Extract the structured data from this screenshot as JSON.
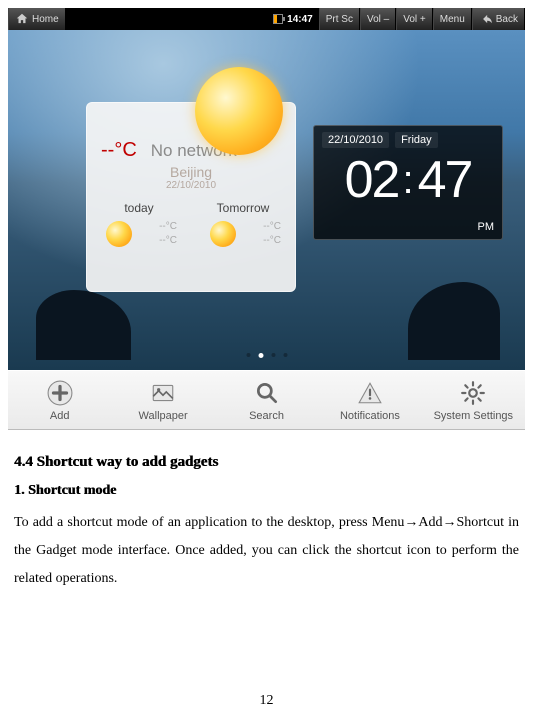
{
  "topbar": {
    "home": "Home",
    "time": "14:47",
    "prtsc": "Prt Sc",
    "vol_dn": "Vol –",
    "vol_up": "Vol +",
    "menu": "Menu",
    "back": "Back"
  },
  "weather": {
    "current_temp": "--°C",
    "status": "No network",
    "location": "Beijing",
    "date": "22/10/2010",
    "today_label": "today",
    "tomorrow_label": "Tomorrow",
    "today_hi": "--°C",
    "today_lo": "--°C",
    "tomorrow_hi": "--°C",
    "tomorrow_lo": "--°C"
  },
  "clock": {
    "date": "22/10/2010",
    "day": "Friday",
    "hours": "02",
    "minutes": "47",
    "pm": "PM"
  },
  "menu": {
    "add": "Add",
    "wallpaper": "Wallpaper",
    "search": "Search",
    "notifications": "Notifications",
    "settings": "System Settings"
  },
  "doc": {
    "h1": "4.4 Shortcut way to add gadgets",
    "h2": "1. Shortcut mode",
    "para": "To add a shortcut mode of an application to the desktop, press Menu→Add→Shortcut in the Gadget mode interface. Once added, you can click the shortcut icon to perform the related operations.",
    "pagenum": "12"
  }
}
